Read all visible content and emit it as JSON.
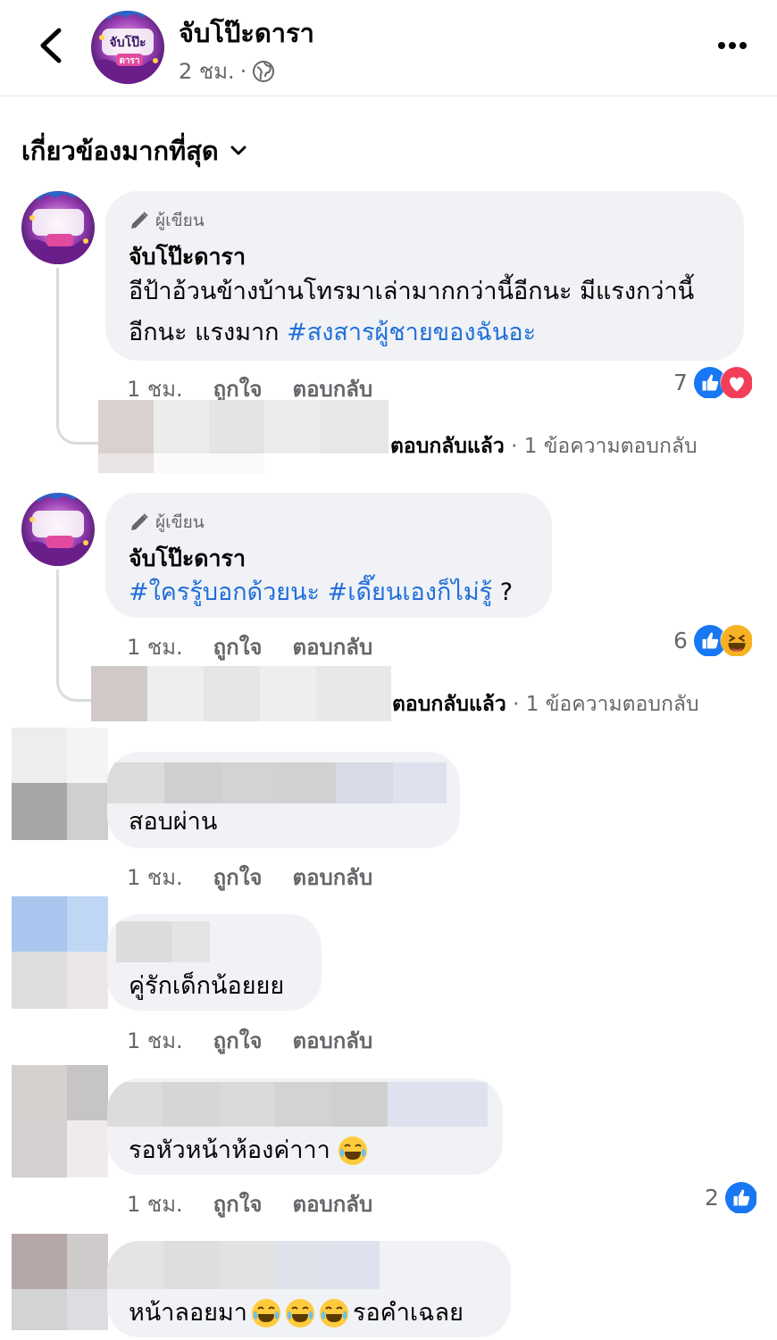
{
  "header": {
    "page_name": "จับโป๊ะดารา",
    "time": "2 ชม.",
    "separator": "·",
    "logo_top": "จับโป๊ะ",
    "logo_bottom": "ดารา"
  },
  "sort": {
    "label": "เกี่ยวข้องมากที่สุด"
  },
  "comments": [
    {
      "author_badge": "ผู้เขียน",
      "author": "จับโป๊ะดารา",
      "text_lines": [
        "อีป้าอ้วนข้างบ้านโทรมาเล่ามากกว่านี้อีกนะ มีแรงกว่านี้",
        "อีกนะ แรงมาก "
      ],
      "hashtag": "#สงสารผู้ชายของฉันอะ",
      "time": "1 ชม.",
      "like": "ถูกใจ",
      "reply": "ตอบกลับ",
      "reaction_count": "7",
      "reply_summary_action": "ตอบกลับแล้ว",
      "reply_summary_sep": " · ",
      "reply_summary_count": "1 ข้อความตอบกลับ"
    },
    {
      "author_badge": "ผู้เขียน",
      "author": "จับโป๊ะดารา",
      "hashtag1": "#ใครรู้บอกด้วยนะ",
      "hashtag2": "#เดี๊ยนเองก็ไม่รู้",
      "trailing": " ?",
      "time": "1 ชม.",
      "like": "ถูกใจ",
      "reply": "ตอบกลับ",
      "reaction_count": "6",
      "reply_summary_action": "ตอบกลับแล้ว",
      "reply_summary_sep": " · ",
      "reply_summary_count": "1 ข้อความตอบกลับ"
    },
    {
      "text": "สอบผ่าน",
      "time": "1 ชม.",
      "like": "ถูกใจ",
      "reply": "ตอบกลับ"
    },
    {
      "text": "คู่รักเด็กน้อยยย",
      "time": "1 ชม.",
      "like": "ถูกใจ",
      "reply": "ตอบกลับ"
    },
    {
      "text": "รอหัวหน้าห้องค่าาา",
      "time": "1 ชม.",
      "like": "ถูกใจ",
      "reply": "ตอบกลับ",
      "reaction_count": "2"
    },
    {
      "text_before": "หน้าลอยมา",
      "text_after": "รอคำเฉลย"
    }
  ],
  "colors": {
    "bubble": "#f0f2f5",
    "secondary_text": "#65676b",
    "hashtag": "#216fdb",
    "like_blue": "#1877f2",
    "love_red": "#f33e58",
    "haha_yellow": "#f7b125"
  },
  "icons": {
    "back": "chevron-left-icon",
    "more": "more-horizontal-icon",
    "globe": "globe-icon",
    "sort": "chevron-down-icon",
    "author": "pencil-icon",
    "like": "like-reaction-icon",
    "love": "love-reaction-icon",
    "haha": "haha-reaction-icon"
  }
}
